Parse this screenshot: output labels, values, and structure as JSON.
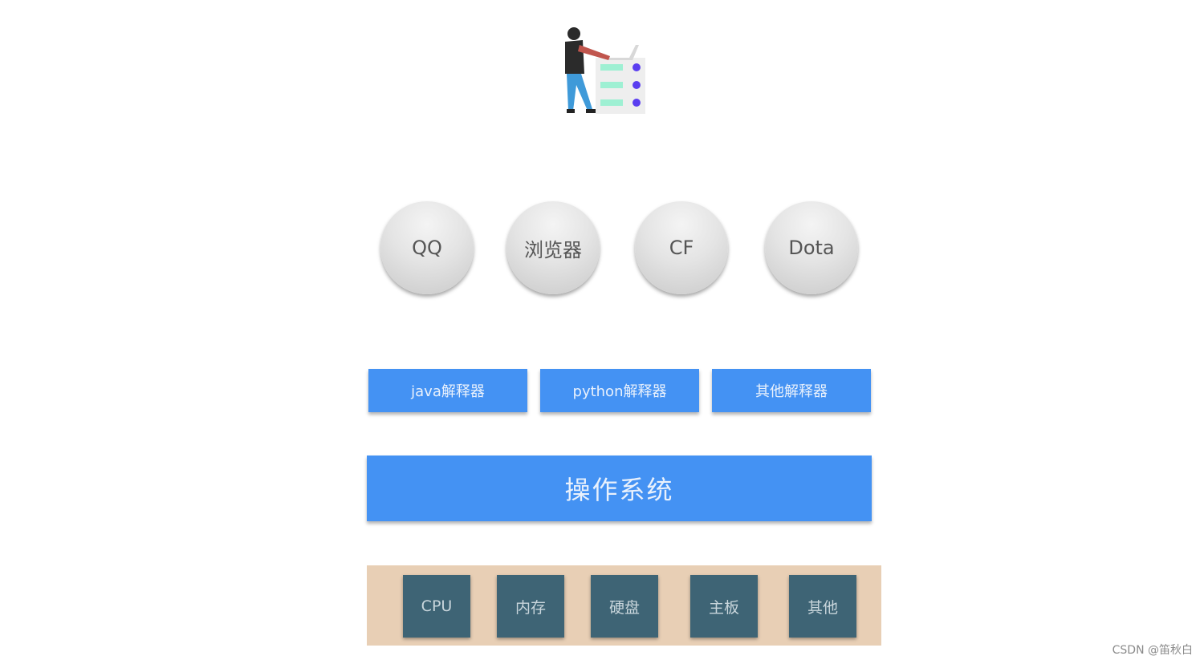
{
  "applications": [
    {
      "label": "QQ"
    },
    {
      "label": "浏览器"
    },
    {
      "label": "CF"
    },
    {
      "label": "Dota"
    }
  ],
  "interpreters": [
    {
      "label": "java解释器"
    },
    {
      "label": "python解释器"
    },
    {
      "label": "其他解释器"
    }
  ],
  "operating_system": {
    "label": "操作系统"
  },
  "hardware": [
    {
      "label": "CPU"
    },
    {
      "label": "内存"
    },
    {
      "label": "硬盘"
    },
    {
      "label": "主板"
    },
    {
      "label": "其他"
    }
  ],
  "watermark": "CSDN @笛秋白",
  "colors": {
    "interpreter_blue": "#4492f3",
    "hardware_tile": "#3e6475",
    "hardware_bg": "#e8cfb5"
  }
}
